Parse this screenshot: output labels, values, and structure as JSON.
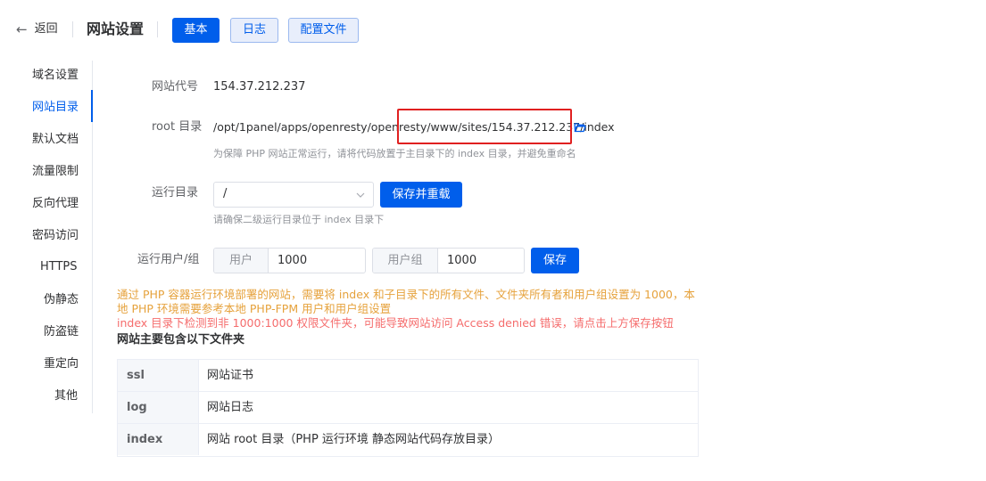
{
  "header": {
    "back_label": "返回",
    "title": "网站设置",
    "tabs": [
      {
        "label": "基本",
        "active": true
      },
      {
        "label": "日志",
        "active": false
      },
      {
        "label": "配置文件",
        "active": false
      }
    ]
  },
  "sidebar": {
    "items": [
      {
        "label": "域名设置"
      },
      {
        "label": "网站目录",
        "active": true
      },
      {
        "label": "默认文档"
      },
      {
        "label": "流量限制"
      },
      {
        "label": "反向代理"
      },
      {
        "label": "密码访问"
      },
      {
        "label": "HTTPS"
      },
      {
        "label": "伪静态"
      },
      {
        "label": "防盗链"
      },
      {
        "label": "重定向"
      },
      {
        "label": "其他"
      }
    ]
  },
  "form": {
    "code_label": "网站代号",
    "code_value": "154.37.212.237",
    "root_label": "root 目录",
    "root_value": "/opt/1panel/apps/openresty/openresty/www/sites/154.37.212.237/index",
    "root_hint": "为保障 PHP 网站正常运行，请将代码放置于主目录下的 index 目录，并避免重命名",
    "run_dir_label": "运行目录",
    "run_dir_value": "/",
    "save_reload_label": "保存并重载",
    "run_dir_hint": "请确保二级运行目录位于 index 目录下",
    "user_group_label": "运行用户/组",
    "user_prefix": "用户",
    "user_value": "1000",
    "group_prefix": "用户组",
    "group_value": "1000",
    "save_label": "保存"
  },
  "notices": {
    "line1": "通过 PHP 容器运行环境部署的网站，需要将 index 和子目录下的所有文件、文件夹所有者和用户组设置为 1000，本",
    "line2": "地 PHP 环境需要参考本地 PHP-FPM 用户和用户组设置",
    "line3": "index 目录下检测到非 1000:1000 权限文件夹，可能导致网站访问 Access denied 错误，请点击上方保存按钮"
  },
  "folders": {
    "title": "网站主要包含以下文件夹",
    "rows": [
      {
        "key": "ssl",
        "value": "网站证书"
      },
      {
        "key": "log",
        "value": "网站日志"
      },
      {
        "key": "index",
        "value": "网站 root 目录（PHP 运行环境 静态网站代码存放目录）"
      }
    ]
  },
  "colors": {
    "primary": "#005eeb",
    "highlight_box": "#e02020",
    "warning": "#e6a23c",
    "danger": "#f56c6c"
  }
}
